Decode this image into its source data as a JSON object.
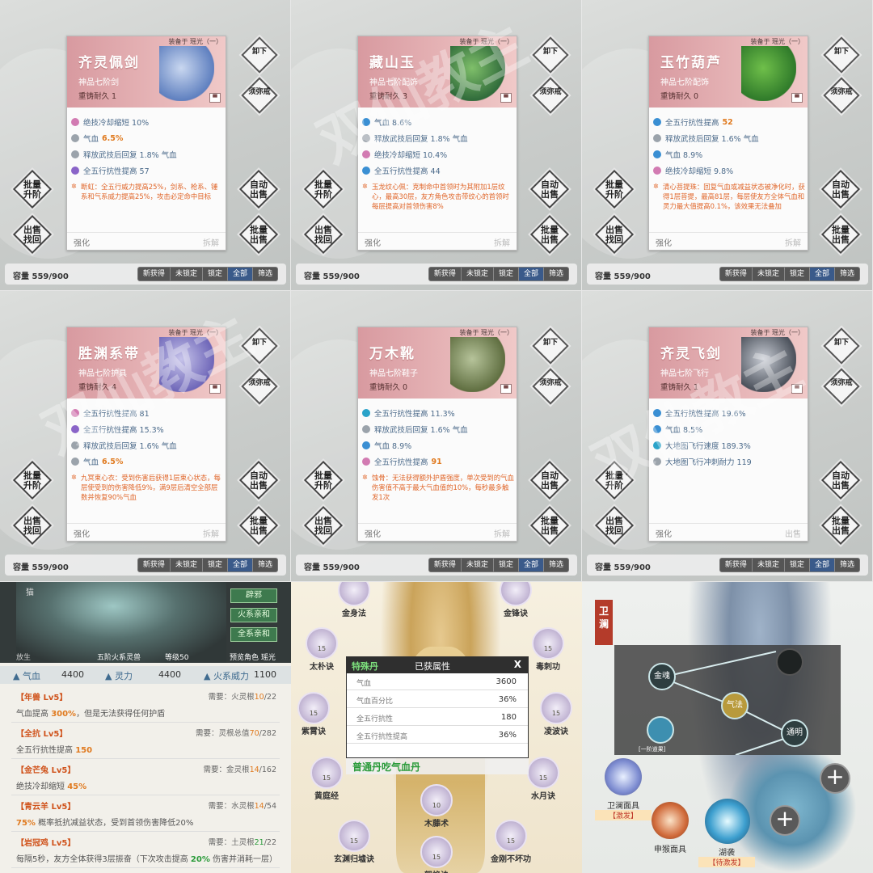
{
  "common": {
    "equipped": "装备于 瑶光（一）",
    "strengthen": "强化",
    "decompose": "拆解",
    "sell": "出售",
    "capacity": "容量 559/900",
    "unequip": "卸下",
    "xumi": "须弥戒",
    "batch_upgrade": [
      "批量",
      "升阶"
    ],
    "auto_sell": [
      "自动",
      "出售"
    ],
    "sell_retrieve": [
      "出售",
      "找回"
    ],
    "batch_sell": [
      "批量",
      "出售"
    ],
    "filters": [
      "新获得",
      "未锁定",
      "锁定",
      "全部",
      "筛选"
    ],
    "watermark": "双仙教主"
  },
  "cards": [
    {
      "name": "齐灵佩剑",
      "grade": "神品七阶剑",
      "durability": "重铸耐久 1",
      "stats": [
        {
          "icon": "pink",
          "text": "绝技冷却缩短 10%",
          "em": ""
        },
        {
          "icon": "grey",
          "text": "气血",
          "em": "6.5%"
        },
        {
          "icon": "grey",
          "text": "释放武技后回复 1.8% 气血",
          "em": ""
        },
        {
          "icon": "purple",
          "text": "全五行抗性提高 57",
          "em": ""
        }
      ],
      "note": "断虹：全五行威力提高25%，剑系、枪系、锤系和气系威力提高25%，攻击必定命中目标"
    },
    {
      "name": "藏山玉",
      "grade": "神品七阶配饰",
      "durability": "重铸耐久 3",
      "stats": [
        {
          "icon": "blue",
          "text": "气血 8.6%",
          "em": ""
        },
        {
          "icon": "grey",
          "text": "释放武技后回复 1.8% 气血",
          "em": ""
        },
        {
          "icon": "pink",
          "text": "绝技冷却缩短 10.4%",
          "em": ""
        },
        {
          "icon": "blue",
          "text": "全五行抗性提高 44",
          "em": ""
        }
      ],
      "note": "玉龙纹心佩：克制命中首领时为其附加1层纹心，最高30层，友方角色攻击带纹心的首领时每层提高对首领伤害8%"
    },
    {
      "name": "玉竹葫芦",
      "grade": "神品七阶配饰",
      "durability": "重铸耐久 0",
      "stats": [
        {
          "icon": "blue",
          "text": "全五行抗性提高",
          "em": "52"
        },
        {
          "icon": "grey",
          "text": "释放武技后回复 1.6% 气血",
          "em": ""
        },
        {
          "icon": "blue",
          "text": "气血 8.9%",
          "em": ""
        },
        {
          "icon": "pink",
          "text": "绝技冷却缩短 9.8%",
          "em": ""
        }
      ],
      "note": "清心菩提珠：回复气血或减益状态被净化时，获得1层菩提，最高81层，每层使友方全体气血和灵力最大值提高0.1%，该效果无法叠加"
    },
    {
      "name": "胜渊系带",
      "grade": "神品七阶护具",
      "durability": "重铸耐久 4",
      "stats": [
        {
          "icon": "pink",
          "text": "全五行抗性提高 81",
          "em": ""
        },
        {
          "icon": "purple",
          "text": "全五行抗性提高 15.3%",
          "em": ""
        },
        {
          "icon": "grey",
          "text": "释放武技后回复 1.6% 气血",
          "em": ""
        },
        {
          "icon": "grey",
          "text": "气血",
          "em": "6.5%"
        }
      ],
      "note": "九冥束心衣：受到伤害后获得1层束心状态，每层使受到的伤害降低9%，满9层后清空全部层数并恢复90%气血"
    },
    {
      "name": "万木靴",
      "grade": "神品七阶鞋子",
      "durability": "重铸耐久 0",
      "stats": [
        {
          "icon": "cyan",
          "text": "全五行抗性提高 11.3%",
          "em": ""
        },
        {
          "icon": "grey",
          "text": "释放武技后回复 1.6% 气血",
          "em": ""
        },
        {
          "icon": "blue",
          "text": "气血 8.9%",
          "em": ""
        },
        {
          "icon": "pink",
          "text": "全五行抗性提高",
          "em": "91"
        }
      ],
      "note": "蚀骨：无法获得额外护盾强度，单次受到的气血伤害值不高于最大气血值的10%，每秒最多触发1次"
    },
    {
      "name": "齐灵飞剑",
      "grade": "神品七阶飞行",
      "durability": "重铸耐久 1",
      "stats": [
        {
          "icon": "blue",
          "text": "全五行抗性提高 19.6%",
          "em": ""
        },
        {
          "icon": "blue",
          "text": "气血 8.5%",
          "em": ""
        },
        {
          "icon": "cyan",
          "text": "大地图飞行速度 189.3%",
          "em": ""
        },
        {
          "icon": "grey",
          "text": "大地图飞行冲刺耐力 119",
          "em": ""
        }
      ],
      "note": ""
    }
  ],
  "beast": {
    "cat": "猫",
    "tags": [
      "辟邪",
      "火系亲和",
      "全系亲和"
    ],
    "grade": "五阶火系灵兽",
    "level": "等级50",
    "preview": "预览角色 瑶光",
    "release": "放生",
    "attrs": [
      {
        "label": "▲ 气血",
        "value": "4400"
      },
      {
        "label": "▲ 灵力",
        "value": "4400"
      },
      {
        "label": "▲ 火系威力",
        "value": "1100"
      }
    ],
    "skills": [
      {
        "name": "【年兽 Lv5】",
        "req": "需要：火灵根",
        "cur": "10",
        "max": "/22",
        "desc1": "气血提高 ",
        "em": "300%",
        "desc2": "，但是无法获得任何护盾"
      },
      {
        "name": "【全抗 Lv5】",
        "req": "需要：灵根总值",
        "cur": "70",
        "max": "/282",
        "desc1": "全五行抗性提高 ",
        "em": "150",
        "desc2": ""
      },
      {
        "name": "【金芒兔 Lv5】",
        "req": "需要：金灵根",
        "cur": "14",
        "max": "/162",
        "desc1": "绝技冷却缩短 ",
        "em": "45%",
        "desc2": ""
      },
      {
        "name": "【青云羊 Lv5】",
        "req": "需要：水灵根",
        "cur": "14",
        "max": "/54",
        "desc1": "",
        "em": "75%",
        "desc2": " 概率抵抗减益状态，受到首领伤害降低20%"
      },
      {
        "name": "【岩冠鸡 Lv5】",
        "req": "需要：土灵根",
        "cur": "21",
        "max": "/22",
        "desc1": "每隔5秒，友方全体获得3层振奋（下次攻击提高 ",
        "em": "20%",
        "desc2": " 伤害并消耗一层）"
      }
    ]
  },
  "pill": {
    "nodes": [
      {
        "name": "金身法",
        "lv": ""
      },
      {
        "name": "金锋诀",
        "lv": ""
      },
      {
        "name": "太朴诀",
        "lv": "15"
      },
      {
        "name": "毒刺功",
        "lv": "15"
      },
      {
        "name": "紫霄诀",
        "lv": "15"
      },
      {
        "name": "凌波诀",
        "lv": "15"
      },
      {
        "name": "黄庭经",
        "lv": "15"
      },
      {
        "name": "水月诀",
        "lv": "15"
      },
      {
        "name": "木藤术",
        "lv": "10"
      },
      {
        "name": "玄渊归墟诀",
        "lv": "15"
      },
      {
        "name": "怒焰诀",
        "lv": "15"
      },
      {
        "name": "金刚不坏功",
        "lv": "15"
      }
    ],
    "popup": {
      "title1": "特殊丹",
      "title2": "已获属性",
      "close": "X",
      "rows": [
        {
          "label": "气血",
          "value": "3600"
        },
        {
          "label": "气血百分比",
          "value": "36%"
        },
        {
          "label": "全五行抗性",
          "value": "180"
        },
        {
          "label": "全五行抗性提高",
          "value": "36%"
        }
      ],
      "footer": "普通丹吃气血丹"
    }
  },
  "weilan": {
    "title": "卫澜",
    "tree_nodes": [
      "金魂",
      "气法",
      "通明"
    ],
    "first": "[一阶道果]",
    "gear": [
      {
        "name": "卫澜面具",
        "sub": "【激发】"
      },
      {
        "name": "申猴面具",
        "sub": ""
      },
      {
        "name": "湖袭",
        "sub": "【待激发】"
      }
    ],
    "plus": "+"
  }
}
